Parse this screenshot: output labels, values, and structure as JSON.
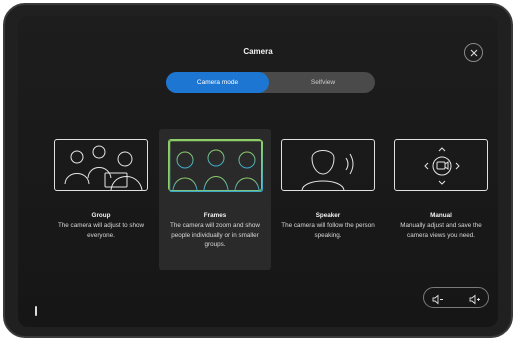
{
  "header": {
    "title": "Camera"
  },
  "tabs": [
    {
      "label": "Camera mode",
      "active": true
    },
    {
      "label": "Selfview",
      "active": false
    }
  ],
  "options": [
    {
      "name": "Group",
      "description": "The camera will adjust to show everyone.",
      "selected": false
    },
    {
      "name": "Frames",
      "description": "The camera will zoom and show people individually or in smaller groups.",
      "selected": true
    },
    {
      "name": "Speaker",
      "description": "The camera will follow the person speaking.",
      "selected": false
    },
    {
      "name": "Manual",
      "description": "Manually adjust and save the camera views you need.",
      "selected": false
    }
  ],
  "icons": {
    "close": "close-icon",
    "volume_down": "volume-down-icon",
    "volume_up": "volume-up-icon"
  },
  "colors": {
    "accent": "#1d76d2",
    "frames_gradient": [
      "#8fcf6a",
      "#3aa6c9"
    ]
  }
}
